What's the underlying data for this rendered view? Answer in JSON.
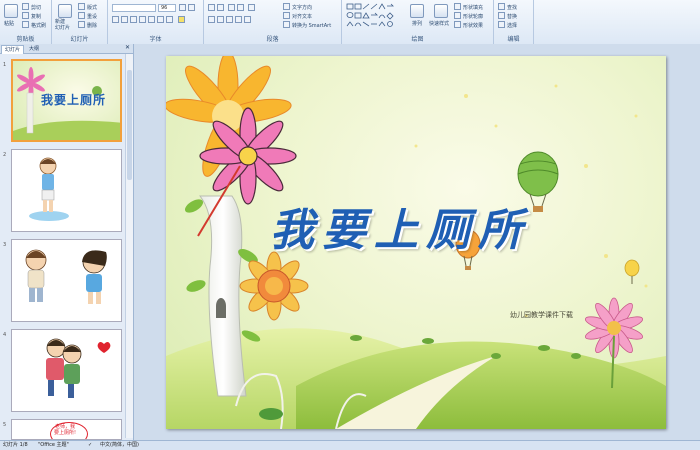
{
  "ribbon": {
    "clipboard": {
      "paste": "粘贴",
      "cut": "剪切",
      "copy": "复制",
      "format_painter": "格式刷",
      "label": "剪贴板"
    },
    "slides": {
      "new_slide": "新建\n幻灯片",
      "layout": "版式",
      "reset": "重设",
      "delete": "删除",
      "label": "幻灯片"
    },
    "font": {
      "size": "96",
      "label": "字体"
    },
    "paragraph": {
      "text_direction": "文字方向",
      "align_text": "对齐文本",
      "smartart": "转换为 SmartArt",
      "label": "段落"
    },
    "drawing": {
      "arrange": "排列",
      "quick_styles": "快速样式",
      "shape_fill": "形状填充",
      "shape_outline": "形状轮廓",
      "shape_effects": "形状效果",
      "label": "绘图"
    },
    "editing": {
      "find": "查找",
      "replace": "替换",
      "select": "选择",
      "label": "编辑"
    }
  },
  "panel": {
    "tabs": [
      "幻灯片",
      "大纲"
    ],
    "slide_numbers": [
      "1",
      "2",
      "3",
      "4",
      "5"
    ],
    "thumb1_title": "我要上厕所",
    "thumb5_text": "老师，我\n要上厕所!"
  },
  "slide": {
    "title": "我要上厕所",
    "watermark": "幼儿园教学课件下载"
  },
  "status": {
    "slide_info": "幻灯片 1/8",
    "theme": "\"Office 主题\"",
    "language": "中文(简体，中国)"
  },
  "colors": {
    "title": "#1f5fb4",
    "ribbon": "#dde8f5",
    "selected_thumb": "#f2a03c"
  }
}
